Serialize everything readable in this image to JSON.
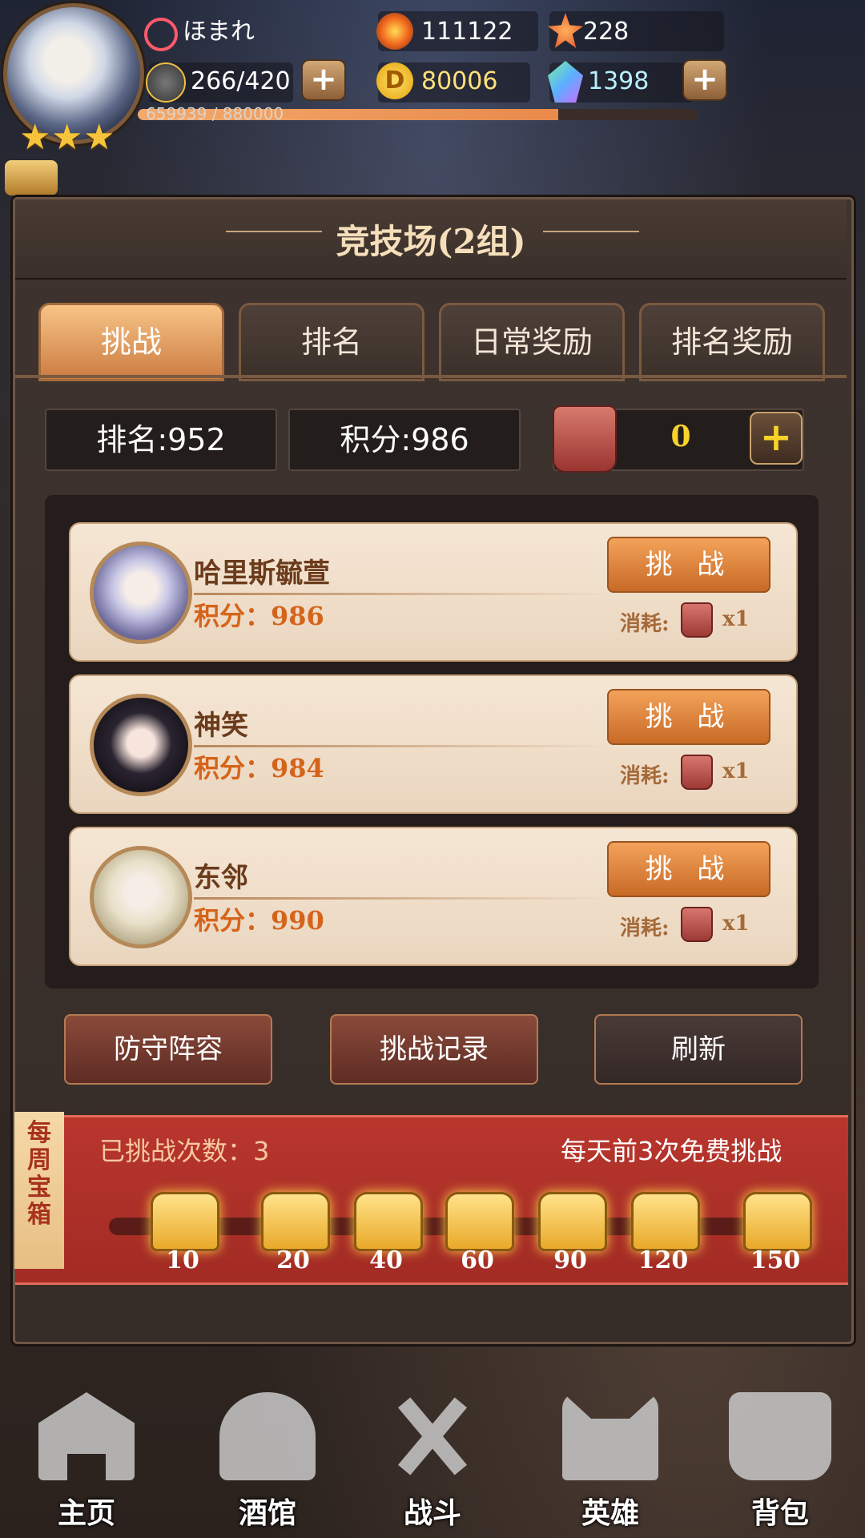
{
  "player": {
    "name": "ほまれ",
    "stamina": "266/420",
    "exp": "659939 / 880000",
    "exp_progress": 0.75,
    "stars": [
      "★",
      "★",
      "★"
    ]
  },
  "currencies": {
    "fire": "111122",
    "gold": "80006",
    "star_gem": "228",
    "crystal": "1398"
  },
  "icons": {
    "plus": "+",
    "gold_symbol": "D"
  },
  "arena": {
    "title": "竞技场(2组)",
    "tabs": [
      "挑战",
      "排名",
      "日常奖励",
      "排名奖励"
    ],
    "rank": "排名:952",
    "score": "积分:986",
    "tickets": "0"
  },
  "opponents": [
    {
      "name": "哈里斯毓萱",
      "score": "积分：986",
      "button": "挑 战",
      "cost_label": "消耗:",
      "cost_qty": "x1"
    },
    {
      "name": "神笑",
      "score": "积分：984",
      "button": "挑 战",
      "cost_label": "消耗:",
      "cost_qty": "x1"
    },
    {
      "name": "东邻",
      "score": "积分：990",
      "button": "挑 战",
      "cost_label": "消耗:",
      "cost_qty": "x1"
    }
  ],
  "actions": {
    "defense": "防守阵容",
    "record": "挑战记录",
    "refresh": "刷新"
  },
  "weekly": {
    "banner": "每周宝箱",
    "count_label": "已挑战次数：3",
    "free_hint": "每天前3次免费挑战",
    "milestones": [
      "10",
      "20",
      "40",
      "60",
      "90",
      "120",
      "150"
    ]
  },
  "nav": [
    "主页",
    "酒馆",
    "战斗",
    "英雄",
    "背包"
  ]
}
